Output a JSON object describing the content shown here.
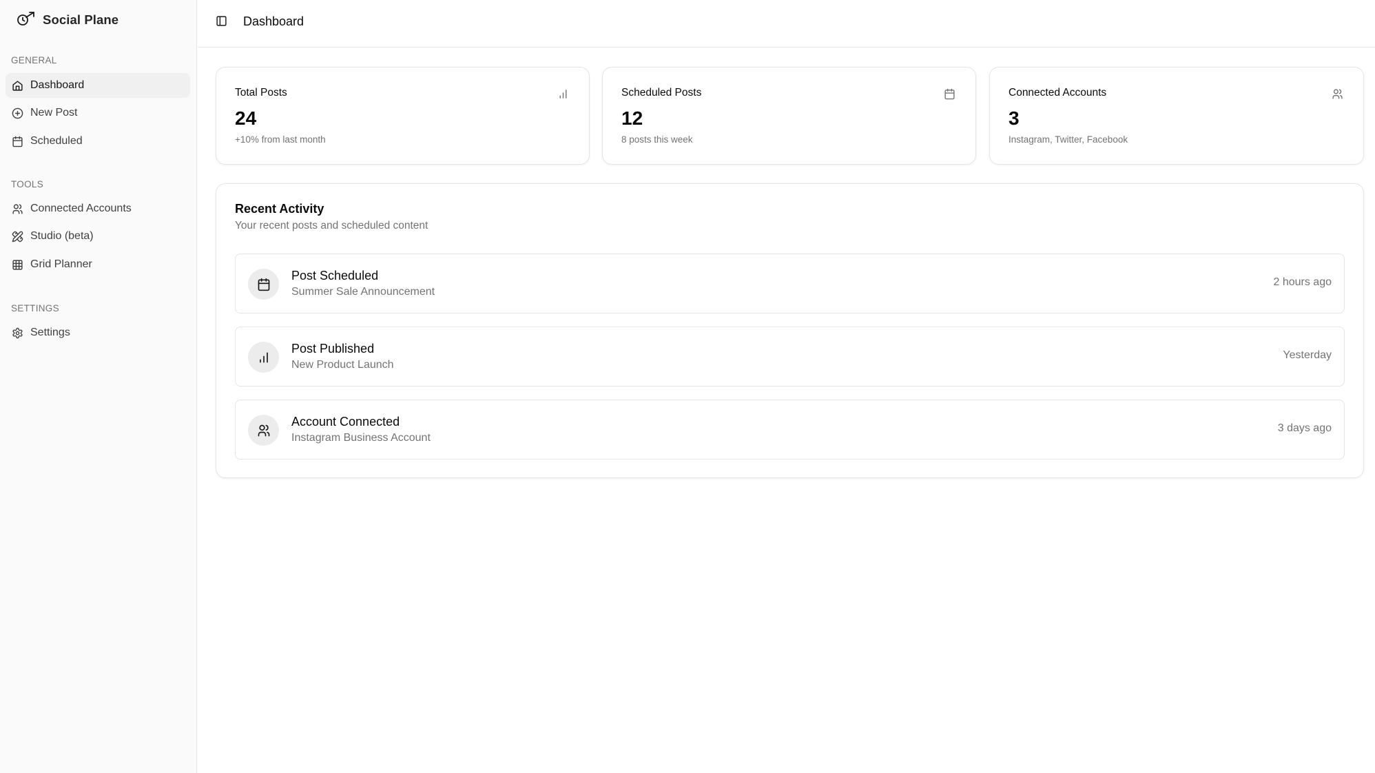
{
  "app": {
    "name": "Social Plane",
    "logo_icon": "plane-clock-icon"
  },
  "sidebar": {
    "sections": [
      {
        "label": "GENERAL",
        "items": [
          {
            "label": "Dashboard",
            "icon": "home-icon",
            "active": true
          },
          {
            "label": "New Post",
            "icon": "plus-circle-icon",
            "active": false
          },
          {
            "label": "Scheduled",
            "icon": "calendar-icon",
            "active": false
          }
        ]
      },
      {
        "label": "TOOLS",
        "items": [
          {
            "label": "Connected Accounts",
            "icon": "users-icon",
            "active": false
          },
          {
            "label": "Studio (beta)",
            "icon": "pencil-ruler-icon",
            "active": false
          },
          {
            "label": "Grid Planner",
            "icon": "grid-icon",
            "active": false
          }
        ]
      },
      {
        "label": "SETTINGS",
        "items": [
          {
            "label": "Settings",
            "icon": "gear-icon",
            "active": false
          }
        ]
      }
    ]
  },
  "header": {
    "toggle_icon": "sidebar-toggle-icon",
    "title": "Dashboard"
  },
  "stats": [
    {
      "label": "Total Posts",
      "value": "24",
      "sub": "+10% from last month",
      "icon": "bar-chart-icon"
    },
    {
      "label": "Scheduled Posts",
      "value": "12",
      "sub": "8 posts this week",
      "icon": "calendar-icon"
    },
    {
      "label": "Connected Accounts",
      "value": "3",
      "sub": "Instagram, Twitter, Facebook",
      "icon": "users-icon"
    }
  ],
  "activity": {
    "title": "Recent Activity",
    "description": "Your recent posts and scheduled content",
    "items": [
      {
        "title": "Post Scheduled",
        "subtitle": "Summer Sale Announcement",
        "time": "2 hours ago",
        "icon": "calendar-icon"
      },
      {
        "title": "Post Published",
        "subtitle": "New Product Launch",
        "time": "Yesterday",
        "icon": "bar-chart-icon"
      },
      {
        "title": "Account Connected",
        "subtitle": "Instagram Business Account",
        "time": "3 days ago",
        "icon": "users-icon"
      }
    ]
  },
  "colors": {
    "sidebar_bg": "#fafafa",
    "active_item_bg": "#f0f0f0",
    "border": "#e5e5e5",
    "muted_text": "#737373",
    "avatar_bg": "#ececec"
  }
}
